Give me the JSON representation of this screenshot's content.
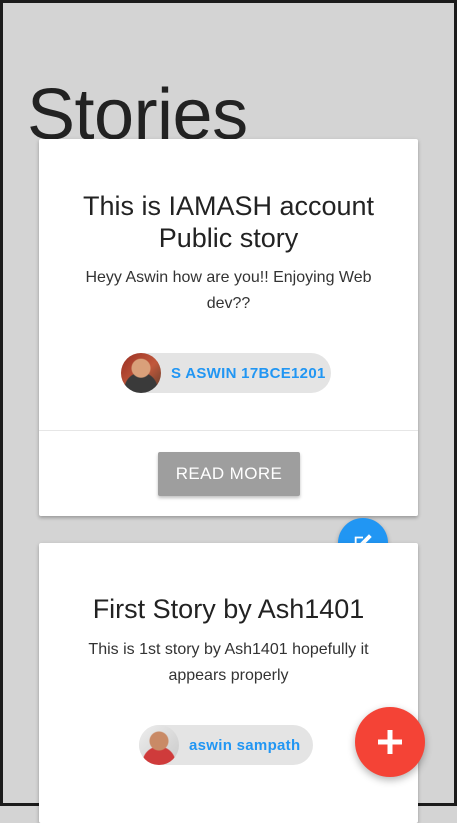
{
  "page": {
    "title": "Stories"
  },
  "stories": [
    {
      "title": "This is IAMASH account Public story",
      "body": "Heyy Aswin how are you!! Enjoying Web dev??",
      "author": "S ASWIN 17BCE1201",
      "action_label": "Read More"
    },
    {
      "title": "First Story by Ash1401",
      "body": "This is 1st story by Ash1401 hopefully it appears properly",
      "author": "aswin sampath"
    }
  ],
  "buttons": {
    "edit_icon": "edit-icon",
    "add_icon": "plus-icon"
  },
  "colors": {
    "background": "#d4d4d4",
    "accent_blue": "#2196f3",
    "fab_red": "#f44336",
    "button_grey": "#9e9e9e"
  }
}
